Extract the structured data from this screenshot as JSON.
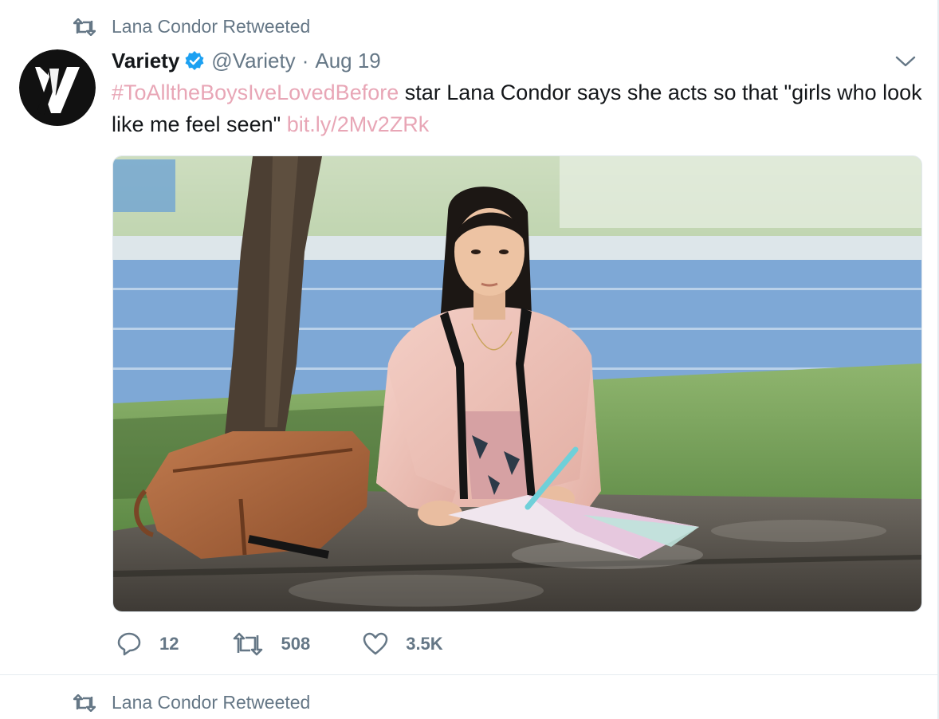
{
  "retweet_context": {
    "text": "Lana Condor Retweeted",
    "icon": "retweet-icon"
  },
  "tweet": {
    "display_name": "Variety",
    "verified": true,
    "handle": "@Variety",
    "separator": "·",
    "date": "Aug 19",
    "text": {
      "hashtag": "#ToAlltheBoysIveLovedBefore",
      "body": " star Lana Condor says she acts so that \"girls who look like me feel seen\" ",
      "link": "bit.ly/2Mv2ZRk"
    },
    "media": {
      "alt": "Lana Condor sitting at a picnic table writing in a notebook"
    },
    "actions": {
      "replies": "12",
      "retweets": "508",
      "likes": "3.5K"
    }
  },
  "next_tweet": {
    "retweet_context": "Lana Condor Retweeted"
  },
  "colors": {
    "link": "#e8a6b6",
    "secondary": "#657786",
    "verified": "#1da1f2",
    "border": "#e6ecf0"
  }
}
